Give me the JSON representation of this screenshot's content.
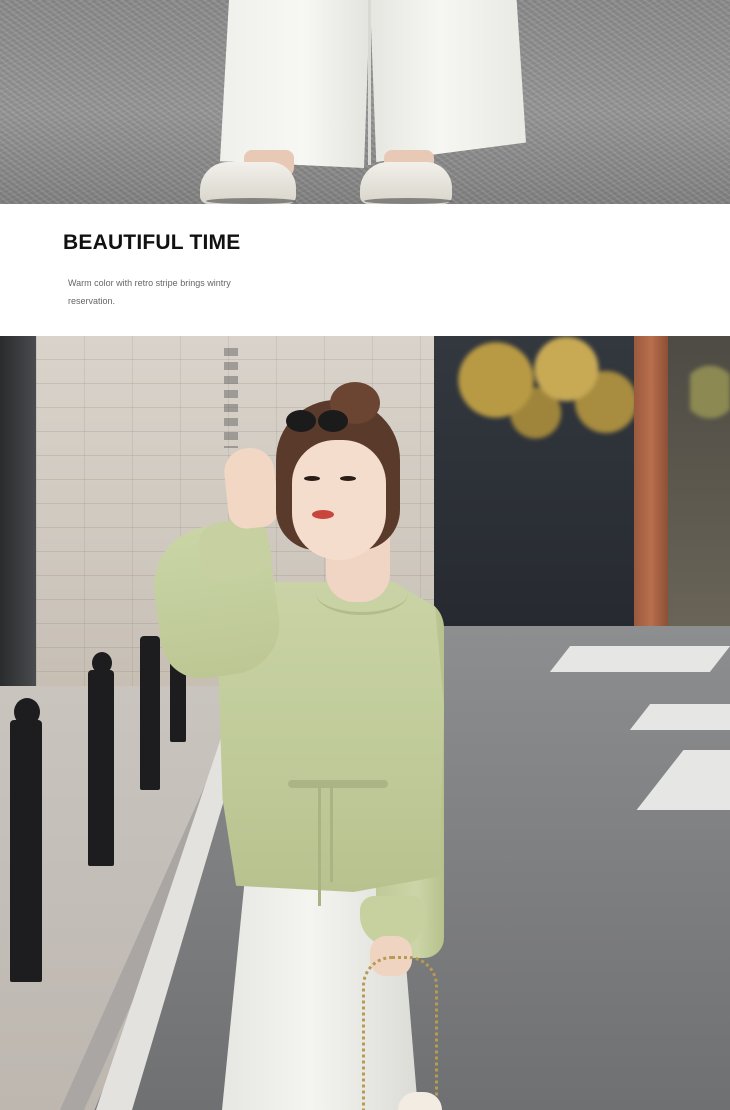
{
  "caption": {
    "title": "BEAUTIFUL TIME",
    "line1": "Warm color with retro stripe brings wintry",
    "line2": "reservation."
  }
}
